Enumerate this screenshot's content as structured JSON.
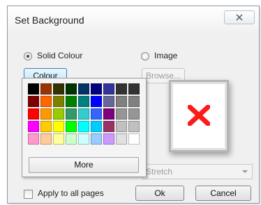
{
  "dialog": {
    "title": "Set Background",
    "close_icon": "close-icon"
  },
  "options": {
    "solid_colour_label": "Solid Colour",
    "solid_colour_selected": true,
    "image_label": "Image",
    "image_selected": false
  },
  "buttons": {
    "colour": "Colour",
    "browse": "Browse...",
    "ok": "Ok",
    "cancel": "Cancel",
    "more": "More"
  },
  "image_mode": {
    "selected": "Stretch"
  },
  "apply_all": {
    "label": "Apply to all pages",
    "checked": false
  },
  "preview": {
    "icon": "broken-image-x-icon",
    "icon_color": "#ff1a1a"
  },
  "palette": {
    "swatches": [
      "#000000",
      "#993300",
      "#333300",
      "#003300",
      "#003366",
      "#000080",
      "#333399",
      "#333333",
      "#333333",
      "#800000",
      "#ff6600",
      "#808000",
      "#008000",
      "#008080",
      "#0000ff",
      "#666699",
      "#808080",
      "#808080",
      "#ff0000",
      "#ff9900",
      "#99cc00",
      "#339966",
      "#33cccc",
      "#3366ff",
      "#800080",
      "#969696",
      "#969696",
      "#ff00ff",
      "#ffcc00",
      "#ffff00",
      "#00ff00",
      "#00ffff",
      "#00ccff",
      "#993366",
      "#c0c0c0",
      "#c0c0c0",
      "#ff99cc",
      "#ffcc99",
      "#ffff99",
      "#ccffcc",
      "#ccffff",
      "#99ccff",
      "#cc99ff",
      "#e0e0e0",
      "#ffffff"
    ]
  }
}
